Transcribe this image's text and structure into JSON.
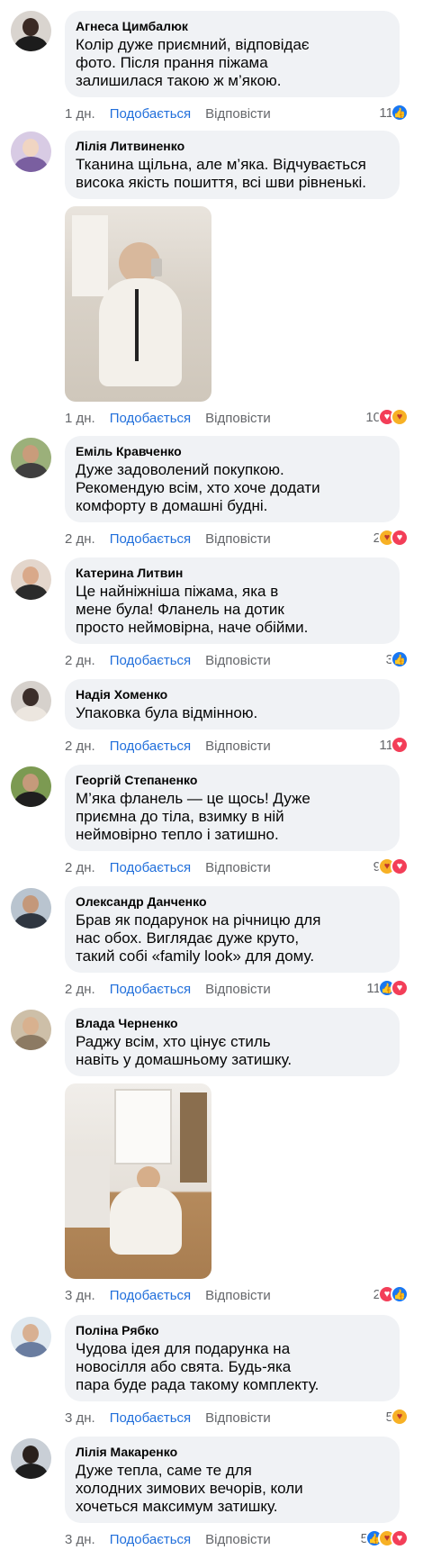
{
  "labels": {
    "like": "Подобається",
    "reply": "Відповісти"
  },
  "comments": [
    {
      "author": "Агнеса Цимбалюк",
      "text": "Колір дуже приємний, відповідає\nфото. Після прання піжама\nзалишилася такою ж м’якою.",
      "time": "1 дн.",
      "reactions": "11"
    },
    {
      "author": "Лілія Литвиненко",
      "text": "Тканина щільна, але м’яка. Відчувається\nвисока якість пошиття, всі шви рівненькі.",
      "time": "1 дн.",
      "reactions": "10"
    },
    {
      "author": "Еміль Кравченко",
      "text": "Дуже задоволений покупкою.\nРекомендую всім, хто хоче додати\nкомфорту в домашні будні.",
      "time": "2 дн.",
      "reactions": "2"
    },
    {
      "author": "Катерина Литвин",
      "text": "Це найніжніша піжама, яка в\nмене була! Фланель на дотик\nпросто неймовірна, наче обійми.",
      "time": "2 дн.",
      "reactions": "3"
    },
    {
      "author": "Надія Хоменко",
      "text": "Упаковка була відмінною.",
      "time": "2 дн.",
      "reactions": "11"
    },
    {
      "author": "Георгій Степаненко",
      "text": "М’яка фланель — це щось! Дуже\nприємна до тіла, взимку в ній\nнеймовірно тепло і затишно.",
      "time": "2 дн.",
      "reactions": "9"
    },
    {
      "author": "Олександр Данченко",
      "text": "Брав як подарунок на річницю для\nнас обох. Виглядає дуже круто,\nтакий собі «family look» для дому.",
      "time": "2 дн.",
      "reactions": "11"
    },
    {
      "author": "Влада Черненко",
      "text": "Раджу всім, хто цінує стиль\nнавіть у домашньому затишку.",
      "time": "3 дн.",
      "reactions": "2"
    },
    {
      "author": "Поліна Рябко",
      "text": "Чудова ідея для подарунка на\nновосілля або свята. Будь-яка\nпара буде рада такому комплекту.",
      "time": "3 дн.",
      "reactions": "5"
    },
    {
      "author": "Лілія Макаренко",
      "text": "Дуже тепла, саме те для\nхолодних зимових вечорів, коли\nхочеться максимум затишку.",
      "time": "3 дн.",
      "reactions": "5"
    }
  ]
}
